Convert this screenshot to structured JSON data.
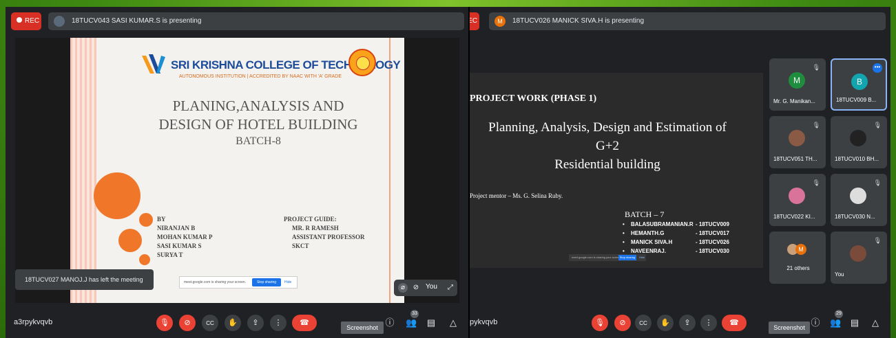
{
  "left": {
    "rec_label": "REC",
    "presenter_text": "18TUCV043 SASI KUMAR.S is presenting",
    "slide": {
      "college": "SRI KRISHNA COLLEGE OF TECHNOLOGY",
      "college_sub": "AUTONOMOUS INSTITUTION | ACCREDITED BY NAAC WITH 'A' GRADE",
      "title_line1": "PLANING,ANALYSIS AND",
      "title_line2": "DESIGN OF HOTEL BUILDING",
      "batch": "BATCH-8",
      "by_list": [
        "BY",
        "NIRANJAN B",
        "MOHAN KUMAR P",
        "SASI KUMAR S",
        "SURYA T"
      ],
      "guide_heading": "PROJECT GUIDE:",
      "guide_list": [
        "MR. R RAMESH",
        "ASSISTANT PROFESSOR",
        "SKCT"
      ],
      "share_text": "meet.google.com is sharing your screen.",
      "stop_sharing": "Stop sharing",
      "hide": "Hide"
    },
    "toast": "18TUCV027 MANOJ.J has left the meeting",
    "self_label": "You",
    "meeting_code": "a3rpykvqvb",
    "tooltip": "Screenshot",
    "people_count": "33"
  },
  "right": {
    "rec_label": "REC",
    "presenter_initial": "M",
    "presenter_text": "18TUCV026 MANICK SIVA.H is presenting",
    "slide": {
      "heading": "PROJECT WORK (PHASE 1)",
      "title_line1": "Planning, Analysis, Design and Estimation of",
      "title_line2": "G+2",
      "title_line3": "Residential building",
      "mentor": "Project mentor – Ms. G. Selina Ruby.",
      "batch": "BATCH – 7",
      "members": [
        {
          "name": "BALASUBRAMANIAN.R",
          "roll": "- 18TUCV009"
        },
        {
          "name": "HEMANTH.G",
          "roll": "- 18TUCV017"
        },
        {
          "name": "MANICK SIVA.H",
          "roll": "- 18TUCV026"
        },
        {
          "name": "NAVEENRAJ.",
          "roll": "- 18TUCV030"
        }
      ],
      "share_text": "meet.google.com is sharing your screen.",
      "stop_sharing": "Stop sharing",
      "hide": "Hide"
    },
    "tiles": [
      {
        "label": "Mr. G. Manikan...",
        "initial": "M",
        "color": "#1e8e3e"
      },
      {
        "label": "18TUCV009 B...",
        "initial": "B",
        "color": "#12a4af"
      },
      {
        "label": "18TUCV051 TH...",
        "initial": "",
        "color": "#8a5a44"
      },
      {
        "label": "18TUCV010 BH...",
        "initial": "",
        "color": "#222222"
      },
      {
        "label": "18TUCV022 KI...",
        "initial": "",
        "color": "#d9739a"
      },
      {
        "label": "18TUCV030 N...",
        "initial": "",
        "color": "#dddddd"
      },
      {
        "label": "21 others",
        "initial": "M",
        "color": "#e8710a"
      },
      {
        "label": "You",
        "initial": "",
        "color": "#7a4a3a"
      }
    ],
    "meeting_code": "pykvqvb",
    "tooltip": "Screenshot",
    "people_count": "29"
  }
}
